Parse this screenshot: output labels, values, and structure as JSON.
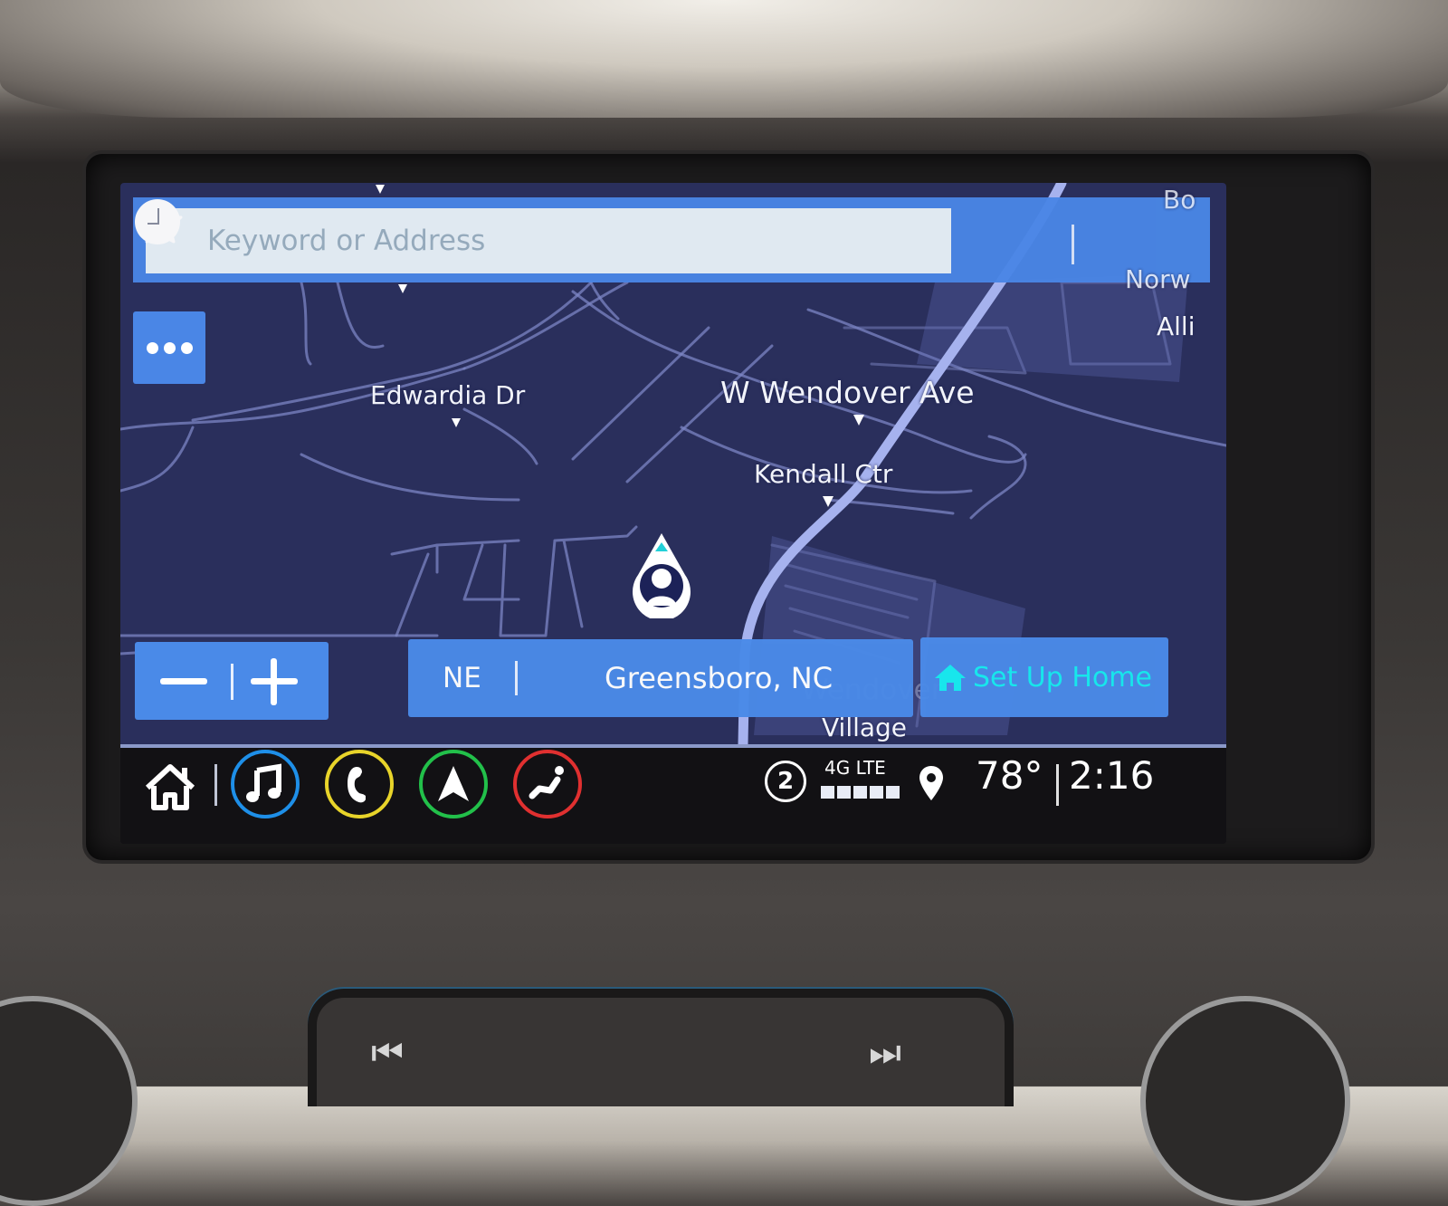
{
  "search": {
    "placeholder": "Keyword or Address",
    "search_icon": "search-icon",
    "favorites_icon": "star-icon",
    "recents_icon": "clock-icon"
  },
  "more_button": {
    "icon": "more-dots-icon"
  },
  "map": {
    "labels": {
      "edwardia": "Edwardia Dr",
      "wendover": "W Wendover Ave",
      "kendall": "Kendall Ctr",
      "wendover_village": "Wendover Village",
      "wendover_village_line1": "Wendover",
      "wendover_village_line2": "Village",
      "edge_top_right": "Bo",
      "edge_norw": "Norw",
      "edge_alli": "Alli"
    },
    "vehicle_icon": "vehicle-position-icon"
  },
  "zoom": {
    "out_label": "−",
    "in_label": "+"
  },
  "location": {
    "heading": "NE",
    "city": "Greensboro, NC"
  },
  "home_button": {
    "label": "Set Up Home",
    "icon": "home-icon",
    "color": "#17ecf0"
  },
  "taskbar": {
    "home_icon": "home-icon",
    "apps": [
      {
        "name": "audio",
        "icon": "music-note-icon",
        "ring_color": "#1e8fe8"
      },
      {
        "name": "phone",
        "icon": "phone-icon",
        "ring_color": "#e8d42a"
      },
      {
        "name": "navigation",
        "icon": "navigation-arrow-icon",
        "ring_color": "#22c04a"
      },
      {
        "name": "climate",
        "icon": "seat-icon",
        "ring_color": "#e03030"
      }
    ]
  },
  "status": {
    "notification_count": "2",
    "network": "4G LTE",
    "signal_bars": 5,
    "signal_bars_max": 5,
    "location_icon": "location-pin-icon",
    "temperature": "78°",
    "time": "2:16"
  }
}
